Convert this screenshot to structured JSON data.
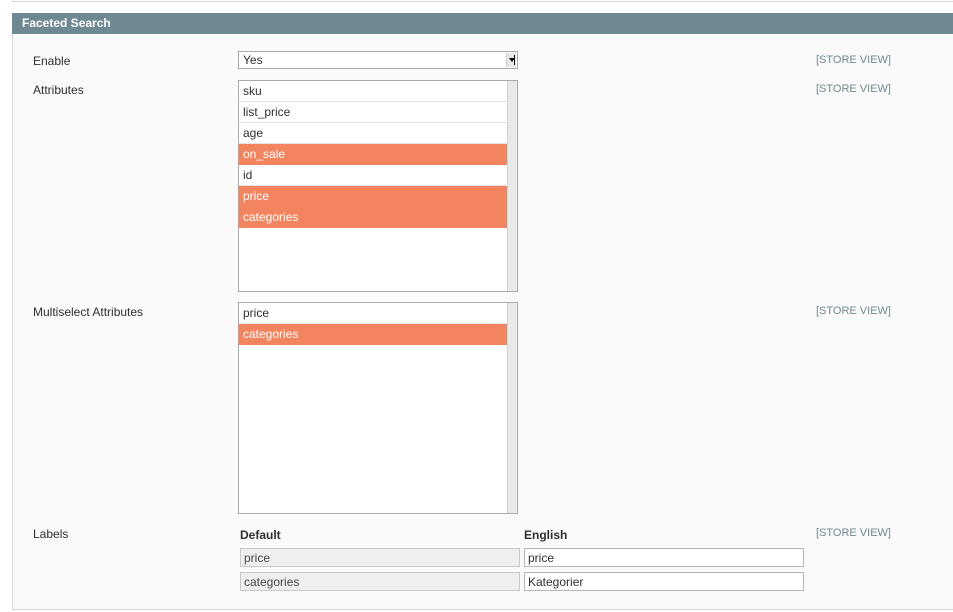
{
  "section": {
    "title": "Faceted Search"
  },
  "scope_label": "[STORE VIEW]",
  "enable": {
    "label": "Enable",
    "value": "Yes"
  },
  "attributes": {
    "label": "Attributes",
    "options": [
      {
        "label": "sku",
        "selected": false
      },
      {
        "label": "list_price",
        "selected": false
      },
      {
        "label": "age",
        "selected": false
      },
      {
        "label": "on_sale",
        "selected": true
      },
      {
        "label": "id",
        "selected": false
      },
      {
        "label": "price",
        "selected": true
      },
      {
        "label": "categories",
        "selected": true
      }
    ]
  },
  "multiselect_attributes": {
    "label": "Multiselect Attributes",
    "options": [
      {
        "label": "price",
        "selected": false
      },
      {
        "label": "categories",
        "selected": true
      }
    ]
  },
  "labels": {
    "label": "Labels",
    "default_header": "Default",
    "english_header": "English",
    "rows": [
      {
        "default": "price",
        "english": "price"
      },
      {
        "default": "categories",
        "english": "Kategorier"
      }
    ]
  },
  "colors": {
    "header_bg": "#6f8992",
    "selected_option_bg": "#f2845f",
    "scope_text": "#6f8992"
  }
}
